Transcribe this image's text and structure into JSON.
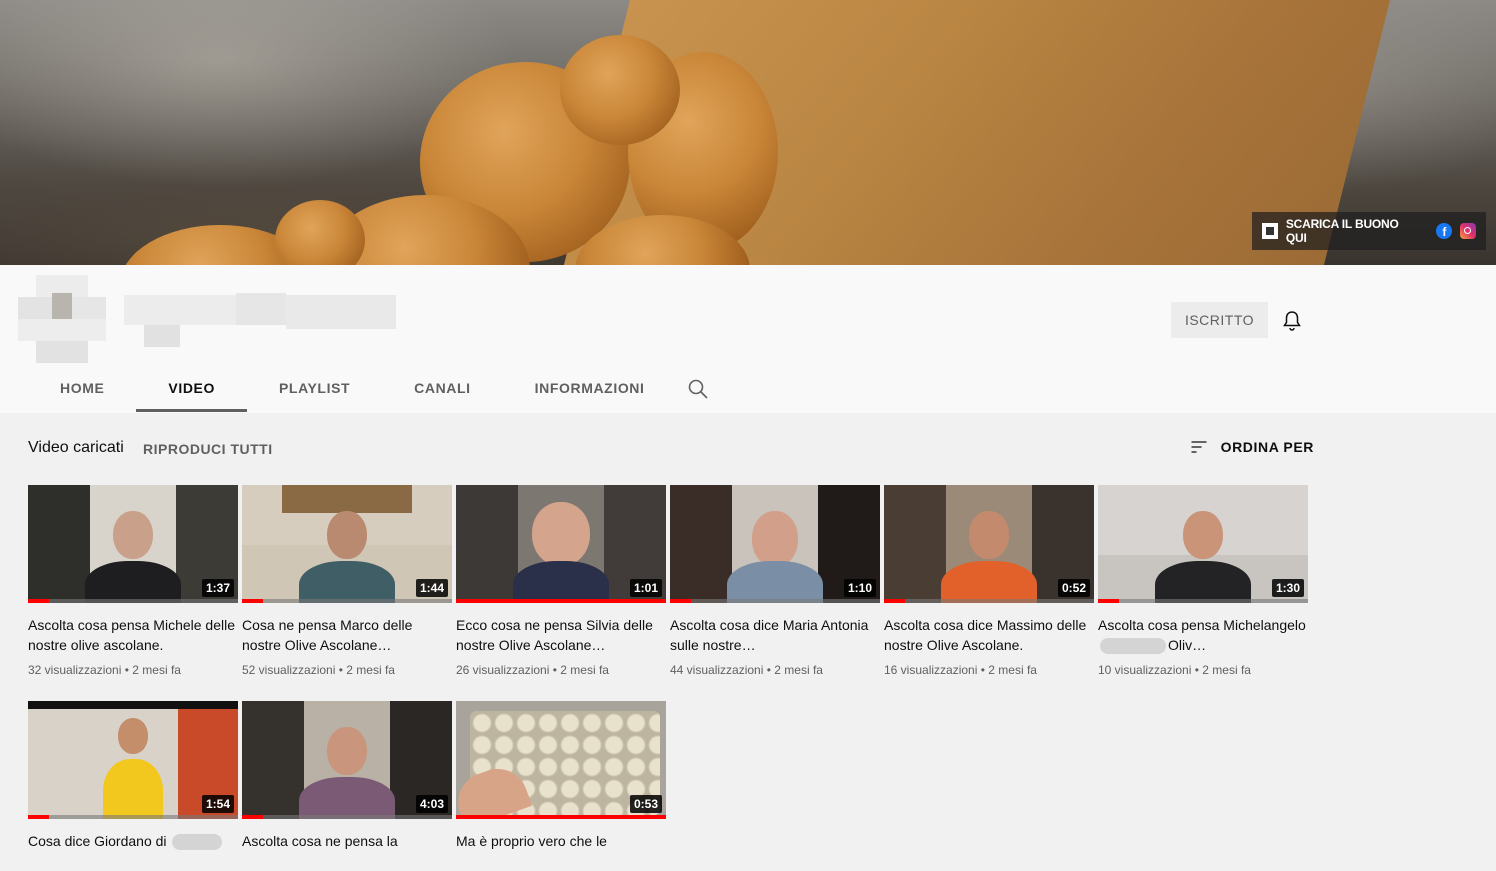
{
  "banner": {
    "links_label": "SCARICA IL BUONO QUI",
    "link_icons": [
      "qr-code-icon",
      "facebook-icon",
      "instagram-icon"
    ]
  },
  "channel": {
    "subscribed_label": "ISCRITTO"
  },
  "tabs": [
    {
      "label": "HOME",
      "active": false
    },
    {
      "label": "VIDEO",
      "active": true
    },
    {
      "label": "PLAYLIST",
      "active": false
    },
    {
      "label": "CANALI",
      "active": false
    },
    {
      "label": "INFORMAZIONI",
      "active": false
    }
  ],
  "section": {
    "title": "Video caricati",
    "play_all": "RIPRODUCI TUTTI",
    "sort_label": "ORDINA PER"
  },
  "videos": [
    {
      "title": "Ascolta cosa pensa Michele delle nostre olive ascolane.",
      "duration": "1:37",
      "views": "32 visualizzazioni",
      "age": "2 mesi fa",
      "progress": 0.1
    },
    {
      "title": "Cosa ne pensa Marco delle nostre Olive Ascolane…",
      "duration": "1:44",
      "views": "52 visualizzazioni",
      "age": "2 mesi fa",
      "progress": 0.1
    },
    {
      "title": "Ecco cosa ne pensa Silvia delle nostre Olive Ascolane…",
      "duration": "1:01",
      "views": "26 visualizzazioni",
      "age": "2 mesi fa",
      "progress": 1.0
    },
    {
      "title": "Ascolta cosa dice Maria Antonia sulle nostre…",
      "duration": "1:10",
      "views": "44 visualizzazioni",
      "age": "2 mesi fa",
      "progress": 0.1
    },
    {
      "title": "Ascolta cosa dice Massimo delle nostre Olive Ascolane.",
      "duration": "0:52",
      "views": "16 visualizzazioni",
      "age": "2 mesi fa",
      "progress": 0.1
    },
    {
      "title_a": "Ascolta cosa pensa Michelangelo",
      "title_b": "Oliv…",
      "duration": "1:30",
      "views": "10 visualizzazioni",
      "age": "2 mesi fa",
      "progress": 0.1
    },
    {
      "title": "Cosa dice Giordano di",
      "duration": "1:54",
      "views": "",
      "age": "",
      "progress": 0.1
    },
    {
      "title": "Ascolta cosa ne pensa la",
      "duration": "4:03",
      "views": "",
      "age": "",
      "progress": 0.1
    },
    {
      "title": "Ma è proprio vero che le",
      "duration": "0:53",
      "views": "",
      "age": "",
      "progress": 1.0
    }
  ],
  "colors": {
    "accent_red": "#ff0000",
    "text_primary": "#0f0f0f",
    "text_secondary": "#606060"
  }
}
